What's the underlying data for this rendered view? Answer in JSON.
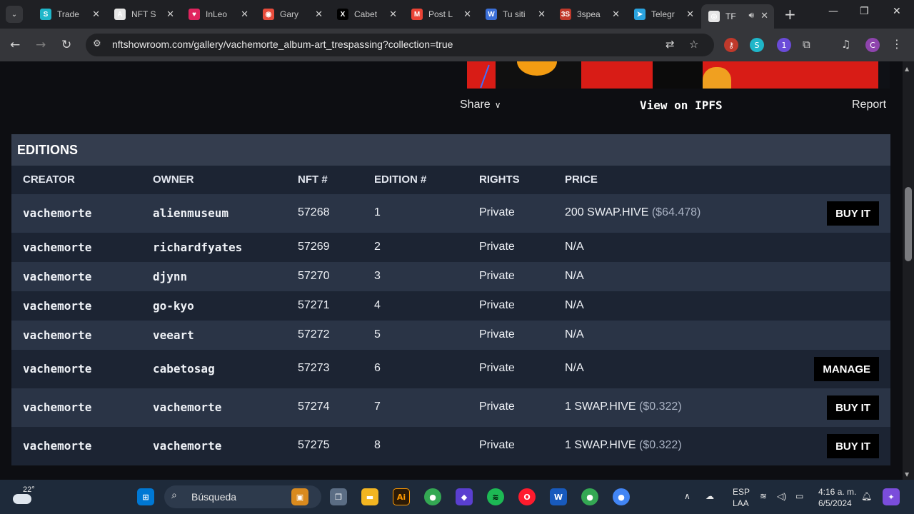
{
  "browser": {
    "tabs": [
      {
        "label": "Trade",
        "favicon": "S",
        "color": "#1fb6c9"
      },
      {
        "label": "NFT S",
        "favicon": "A",
        "color": "#e6e6e6"
      },
      {
        "label": "InLeo",
        "favicon": "♥",
        "color": "#e0245e"
      },
      {
        "label": "Gary",
        "favicon": "◉",
        "color": "#e74c3c"
      },
      {
        "label": "Cabet",
        "favicon": "X",
        "color": "#000000"
      },
      {
        "label": "Post L",
        "favicon": "M",
        "color": "#ea4335"
      },
      {
        "label": "Tu siti",
        "favicon": "W",
        "color": "#3b6fd8"
      },
      {
        "label": "3spea",
        "favicon": "3S",
        "color": "#c0392b"
      },
      {
        "label": "Telegr",
        "favicon": "➤",
        "color": "#2aa3df"
      },
      {
        "label": "TF",
        "favicon": "◎",
        "color": "#e6e6e6"
      }
    ],
    "url": "nftshowroom.com/gallery/vachemorte_album-art_trespassing?collection=true",
    "profile_initial": "C",
    "extension_badge": "1"
  },
  "artwork_links": {
    "share": "Share",
    "view_ipfs": "View on IPFS",
    "report": "Report"
  },
  "editions": {
    "title": "EDITIONS",
    "columns": [
      "CREATOR",
      "OWNER",
      "NFT #",
      "EDITION #",
      "RIGHTS",
      "PRICE"
    ],
    "rows": [
      {
        "creator": "vachemorte",
        "owner": "alienmuseum",
        "nft": "57268",
        "edition": "1",
        "rights": "Private",
        "price": "200 SWAP.HIVE",
        "usd": "($64.478)",
        "action": "BUY IT"
      },
      {
        "creator": "vachemorte",
        "owner": "richardfyates",
        "nft": "57269",
        "edition": "2",
        "rights": "Private",
        "price": "N/A",
        "usd": "",
        "action": ""
      },
      {
        "creator": "vachemorte",
        "owner": "djynn",
        "nft": "57270",
        "edition": "3",
        "rights": "Private",
        "price": "N/A",
        "usd": "",
        "action": ""
      },
      {
        "creator": "vachemorte",
        "owner": "go-kyo",
        "nft": "57271",
        "edition": "4",
        "rights": "Private",
        "price": "N/A",
        "usd": "",
        "action": ""
      },
      {
        "creator": "vachemorte",
        "owner": "veeart",
        "nft": "57272",
        "edition": "5",
        "rights": "Private",
        "price": "N/A",
        "usd": "",
        "action": ""
      },
      {
        "creator": "vachemorte",
        "owner": "cabetosag",
        "nft": "57273",
        "edition": "6",
        "rights": "Private",
        "price": "N/A",
        "usd": "",
        "action": "MANAGE"
      },
      {
        "creator": "vachemorte",
        "owner": "vachemorte",
        "nft": "57274",
        "edition": "7",
        "rights": "Private",
        "price": "1 SWAP.HIVE",
        "usd": "($0.322)",
        "action": "BUY IT"
      },
      {
        "creator": "vachemorte",
        "owner": "vachemorte",
        "nft": "57275",
        "edition": "8",
        "rights": "Private",
        "price": "1 SWAP.HIVE",
        "usd": "($0.322)",
        "action": "BUY IT"
      }
    ]
  },
  "taskbar": {
    "temperature": "22°",
    "search_placeholder": "Búsqueda",
    "language_top": "ESP",
    "language_bottom": "LAA",
    "time": "4:16 a. m.",
    "date": "6/5/2024"
  }
}
